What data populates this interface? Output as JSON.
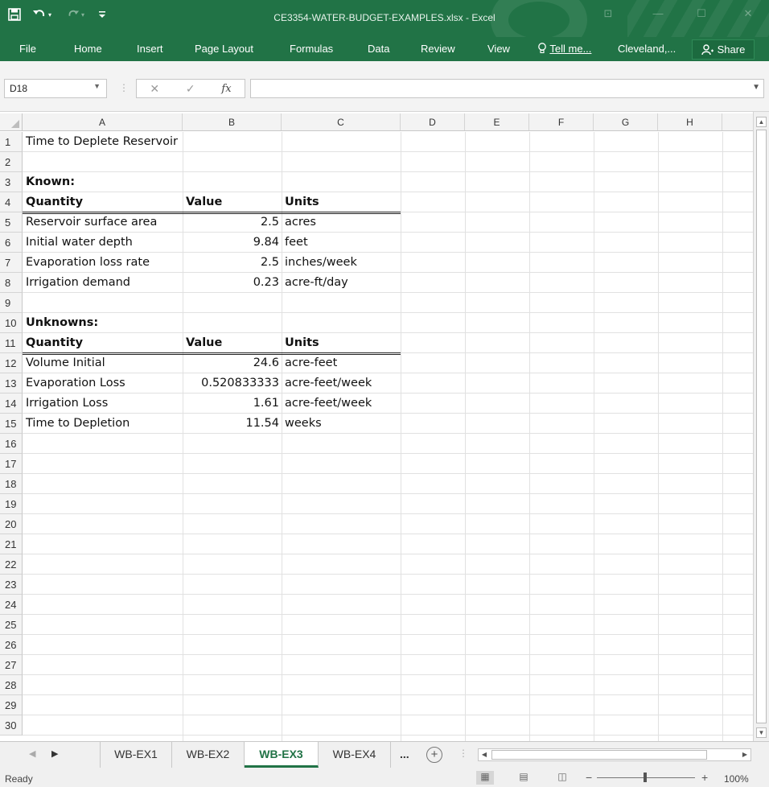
{
  "window": {
    "title": "CE3354-WATER-BUDGET-EXAMPLES.xlsx - Excel"
  },
  "ribbon": {
    "tabs": [
      "File",
      "Home",
      "Insert",
      "Page Layout",
      "Formulas",
      "Data",
      "Review",
      "View"
    ],
    "tell_me": "Tell me...",
    "account": "Cleveland,...",
    "share": "Share"
  },
  "formula_bar": {
    "name_box": "D18",
    "fx": "fx",
    "formula": ""
  },
  "columns": [
    "A",
    "B",
    "C",
    "D",
    "E",
    "F",
    "G",
    "H"
  ],
  "rows": [
    "1",
    "2",
    "3",
    "4",
    "5",
    "6",
    "7",
    "8",
    "9",
    "10",
    "11",
    "12",
    "13",
    "14",
    "15",
    "16",
    "17",
    "18",
    "19",
    "20",
    "21",
    "22",
    "23",
    "24",
    "25",
    "26",
    "27",
    "28",
    "29",
    "30"
  ],
  "cells": {
    "A1": "Time to Deplete Reservoir",
    "A3": "Known:",
    "A4": "Quantity",
    "B4": "Value",
    "C4": "Units",
    "A5": "Reservoir surface area",
    "B5": "2.5",
    "C5": "acres",
    "A6": "Initial water depth",
    "B6": "9.84",
    "C6": "feet",
    "A7": "Evaporation loss rate",
    "B7": "2.5",
    "C7": "inches/week",
    "A8": "Irrigation demand",
    "B8": "0.23",
    "C8": "acre-ft/day",
    "A10": "Unknowns:",
    "A11": "Quantity",
    "B11": "Value",
    "C11": "Units",
    "A12": "Volume Initial",
    "B12": "24.6",
    "C12": "acre-feet",
    "A13": "Evaporation Loss",
    "B13": "0.520833333",
    "C13": "acre-feet/week",
    "A14": "Irrigation Loss",
    "B14": "1.61",
    "C14": "acre-feet/week",
    "A15": "Time to Depletion",
    "B15": "11.54",
    "C15": "weeks"
  },
  "sheet_tabs": {
    "tabs": [
      "WB-EX1",
      "WB-EX2",
      "WB-EX3",
      "WB-EX4"
    ],
    "active": "WB-EX3",
    "more": "..."
  },
  "status_bar": {
    "mode": "Ready",
    "zoom": "100%"
  },
  "theme": {
    "accent": "#217346"
  },
  "icons": {
    "save": "save-icon",
    "undo": "undo-icon",
    "redo": "redo-icon",
    "tell_me": "lightbulb-icon",
    "share": "person-icon"
  }
}
